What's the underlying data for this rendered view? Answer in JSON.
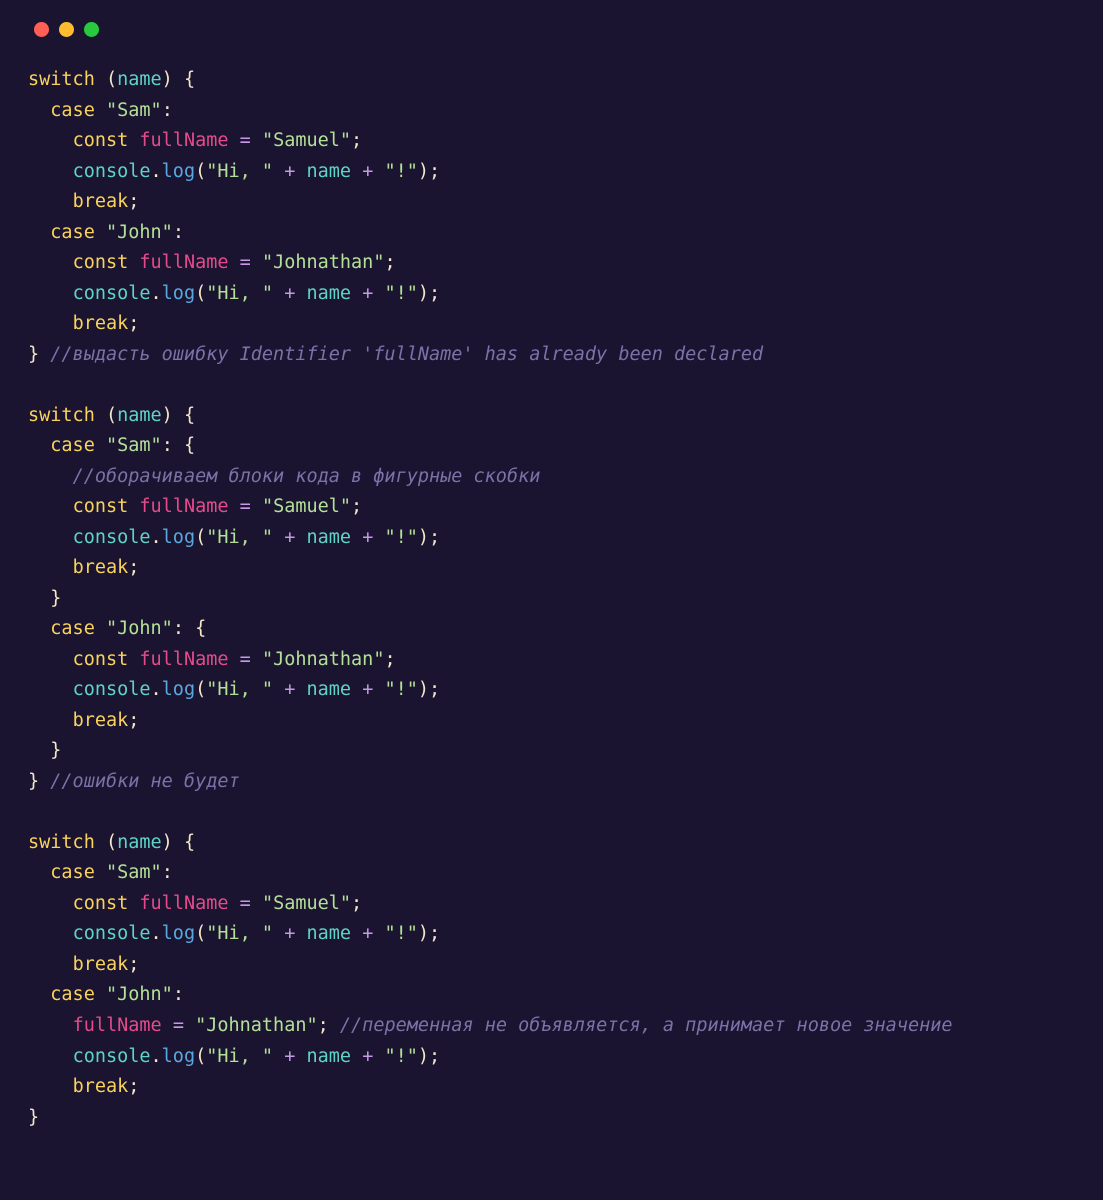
{
  "window": {
    "dot_red": "#ff5f56",
    "dot_yellow": "#ffbd2e",
    "dot_green": "#27c93f"
  },
  "t": {
    "switch": "switch",
    "case": "case",
    "const": "const",
    "break": "break",
    "name": "name",
    "fullName": "fullName",
    "console": "console",
    "log": "log",
    "sam": "\"Sam\"",
    "john": "\"John\"",
    "samuel": "\"Samuel\"",
    "johnathan": "\"Johnathan\"",
    "hi": "\"Hi, \"",
    "excl": "\"!\"",
    "lbrace": "{",
    "rbrace": "}",
    "lparen": "(",
    "rparen": ")",
    "colon": ":",
    "semi": ";",
    "eq": "=",
    "plus": "+",
    "dot": ".",
    "cmt1": "//выдасть ошибку Identifier 'fullName' has already been declared",
    "cmt2": "//оборачиваем блоки кода в фигурные скобки",
    "cmt3": "//ошибки не будет",
    "cmt4": "//переменная не объявляется, а принимает новое значение"
  }
}
